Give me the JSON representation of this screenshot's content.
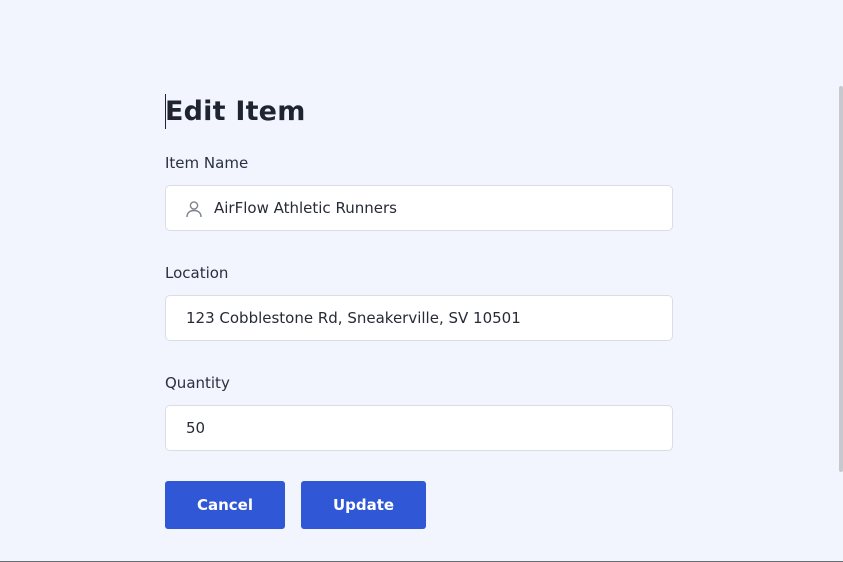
{
  "form": {
    "title": "Edit Item",
    "item_name": {
      "label": "Item Name",
      "value": "AirFlow Athletic Runners",
      "icon": "user-icon"
    },
    "location": {
      "label": "Location",
      "value": "123 Cobblestone Rd, Sneakerville, SV 10501"
    },
    "quantity": {
      "label": "Quantity",
      "value": "50"
    }
  },
  "buttons": {
    "cancel_label": "Cancel",
    "update_label": "Update"
  },
  "colors": {
    "background": "#f2f5fd",
    "primary_button": "#3057d5",
    "field_border": "#d9dde6",
    "text": "#1f2530"
  }
}
